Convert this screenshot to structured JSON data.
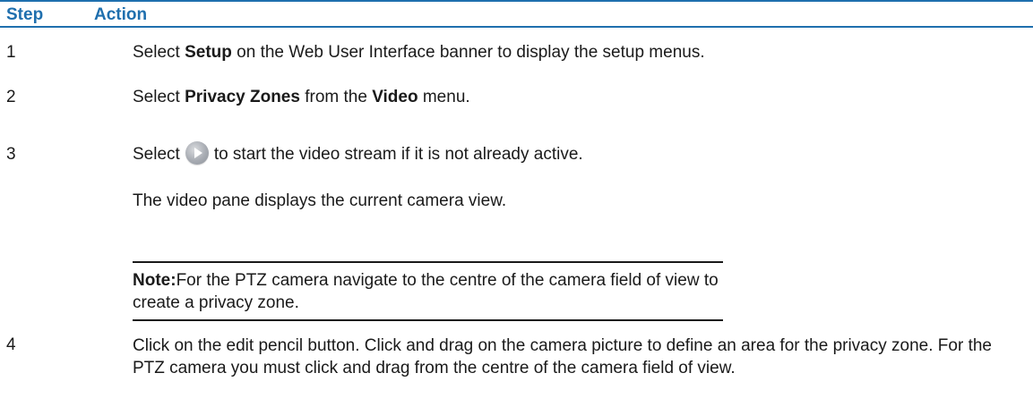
{
  "table": {
    "headers": {
      "step": "Step",
      "action": "Action"
    },
    "rows": [
      {
        "step": "1",
        "pre": "Select ",
        "bold1": "Setup",
        "post": " on the Web User Interface banner to display the setup menus."
      },
      {
        "step": "2",
        "pre": "Select ",
        "bold1": "Privacy Zones",
        "mid": " from the ",
        "bold2": "Video",
        "post": " menu."
      },
      {
        "step": "3",
        "pre": "Select",
        "icon": "play-button-icon",
        "post": "to start the video stream if it is not already active.",
        "line2": "The video pane displays the current camera view.",
        "note_label": "Note:",
        "note_text": "For the PTZ camera navigate to the centre of the camera field of view to create a privacy zone."
      },
      {
        "step": "4",
        "text": "Click on the edit pencil button. Click and drag on the camera picture to define an area for the privacy zone. For the PTZ camera you must click and drag from the centre of the camera field of view."
      }
    ]
  },
  "colors": {
    "header_text": "#1f6fae",
    "header_rule": "#1f6fae",
    "body_text": "#1a1a1a"
  }
}
